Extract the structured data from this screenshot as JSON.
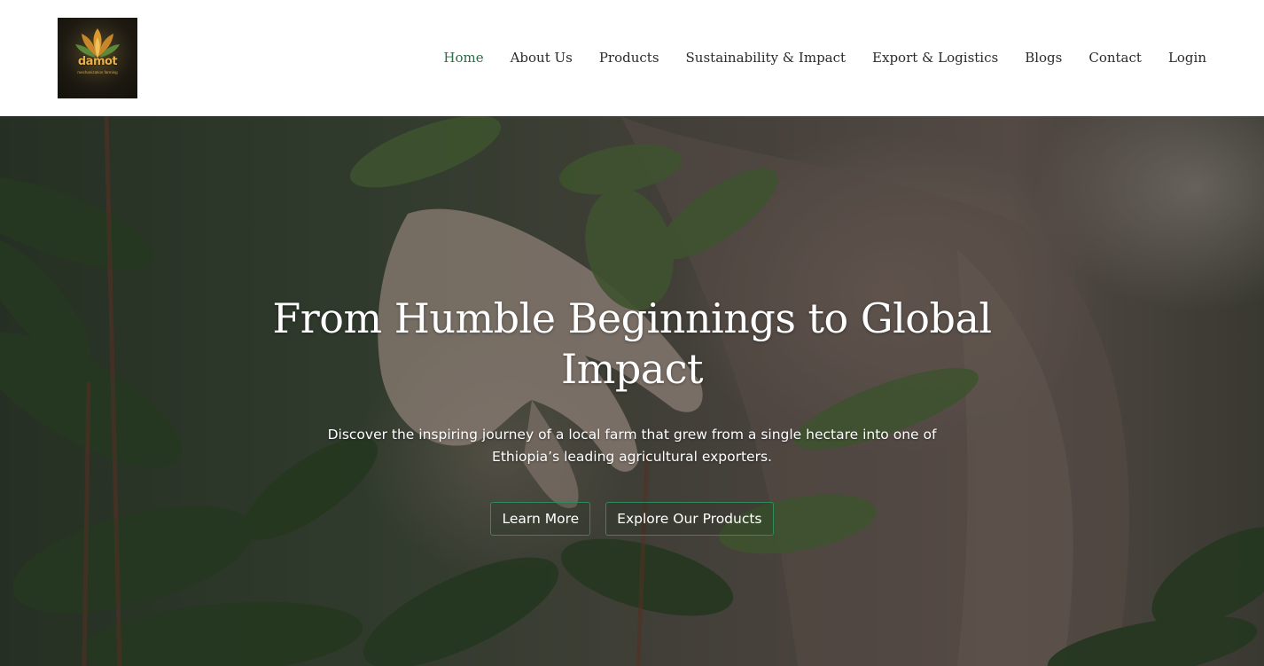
{
  "header": {
    "logo": {
      "word": "damot",
      "subtext": "mechanization farming",
      "icon": "wheat-leaf-logo-icon"
    },
    "nav": [
      {
        "label": "Home",
        "active": true
      },
      {
        "label": "About Us",
        "active": false
      },
      {
        "label": "Products",
        "active": false
      },
      {
        "label": "Sustainability & Impact",
        "active": false
      },
      {
        "label": "Export & Logistics",
        "active": false
      },
      {
        "label": "Blogs",
        "active": false
      },
      {
        "label": "Contact",
        "active": false
      },
      {
        "label": "Login",
        "active": false
      }
    ]
  },
  "hero": {
    "title": "From Humble Beginnings to Global Impact",
    "subtitle": "Discover the inspiring journey of a local farm that grew from a single hectare into one of Ethiopia’s leading agricultural exporters.",
    "buttons": {
      "learn_more": "Learn More",
      "explore_products": "Explore Our Products"
    }
  },
  "colors": {
    "nav_active": "#2e6b48",
    "nav_text": "#2b2b2b",
    "button_border": "#2f8a5c",
    "logo_gold": "#e8b04a"
  }
}
